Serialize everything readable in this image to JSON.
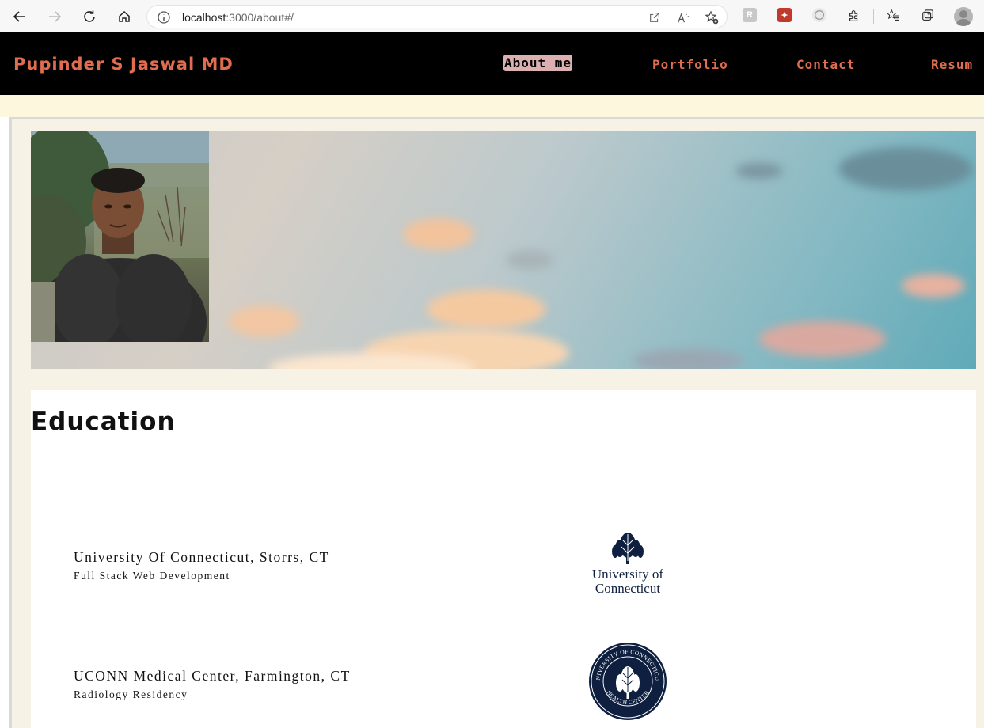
{
  "browser": {
    "url_host": "localhost",
    "url_rest": ":3000/about#/"
  },
  "site": {
    "brand": "Pupinder S Jaswal MD",
    "nav": [
      {
        "label": "About me",
        "active": true
      },
      {
        "label": "Portfolio",
        "active": false
      },
      {
        "label": "Contact",
        "active": false
      },
      {
        "label": "Resum",
        "active": false
      }
    ]
  },
  "education": {
    "title": "Education",
    "items": [
      {
        "school": "University Of Connecticut, Storrs, CT",
        "program": "Full Stack Web Development",
        "logo_line1": "University of",
        "logo_line2": "Connecticut"
      },
      {
        "school": "UCONN Medical Center, Farmington, CT",
        "program": "Radiology Residency",
        "seal_top": "UNIVERSITY OF CONNECTICUT",
        "seal_bottom": "HEALTH CENTER"
      }
    ]
  },
  "colors": {
    "nav_bg": "#000000",
    "brand": "#e06d4f",
    "active_pill": "#dcb0b0",
    "page_band": "#fdf7dd",
    "logo_navy": "#0e1f3f"
  }
}
